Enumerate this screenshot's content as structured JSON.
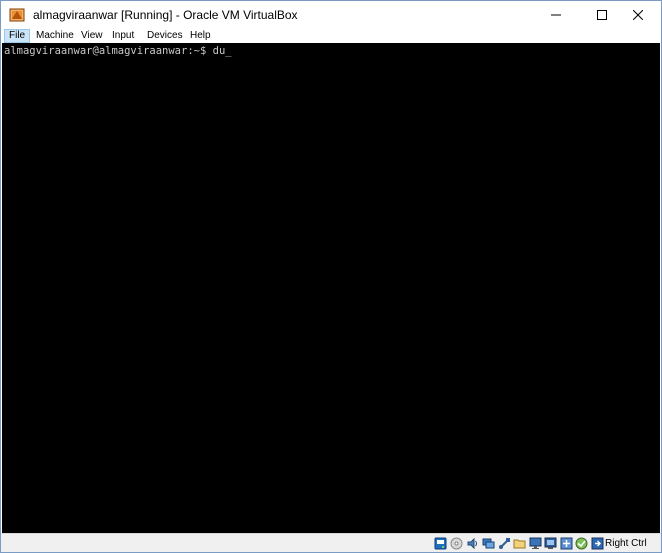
{
  "window": {
    "title": "almagviraanwar [Running] - Oracle VM VirtualBox"
  },
  "menu": {
    "items": [
      {
        "label": "File"
      },
      {
        "label": "Machine"
      },
      {
        "label": "View"
      },
      {
        "label": "Input"
      },
      {
        "label": "Devices"
      },
      {
        "label": "Help"
      }
    ],
    "active_item": "File"
  },
  "terminal": {
    "prompt": "almagviraanwar@almagviraanwar:~$ ",
    "command": "du",
    "cursor": "_",
    "background": "#000000",
    "foreground": "#c8c8c8"
  },
  "statusbar": {
    "icons": [
      "hard-disk-icon",
      "optical-drive-icon",
      "audio-icon",
      "network-icon",
      "usb-icon",
      "shared-folders-icon",
      "display-icon",
      "video-capture-icon",
      "guest-additions-icon",
      "cpu-icon",
      "mouse-integration-icon",
      "keyboard-arrow-icon"
    ],
    "host_key": "Right Ctrl"
  },
  "colors": {
    "titlebar": "#ffffff",
    "menu_active_bg": "#cce4f7",
    "statusbar": "#f0f0f0",
    "window_border": "#7a9cc4"
  }
}
